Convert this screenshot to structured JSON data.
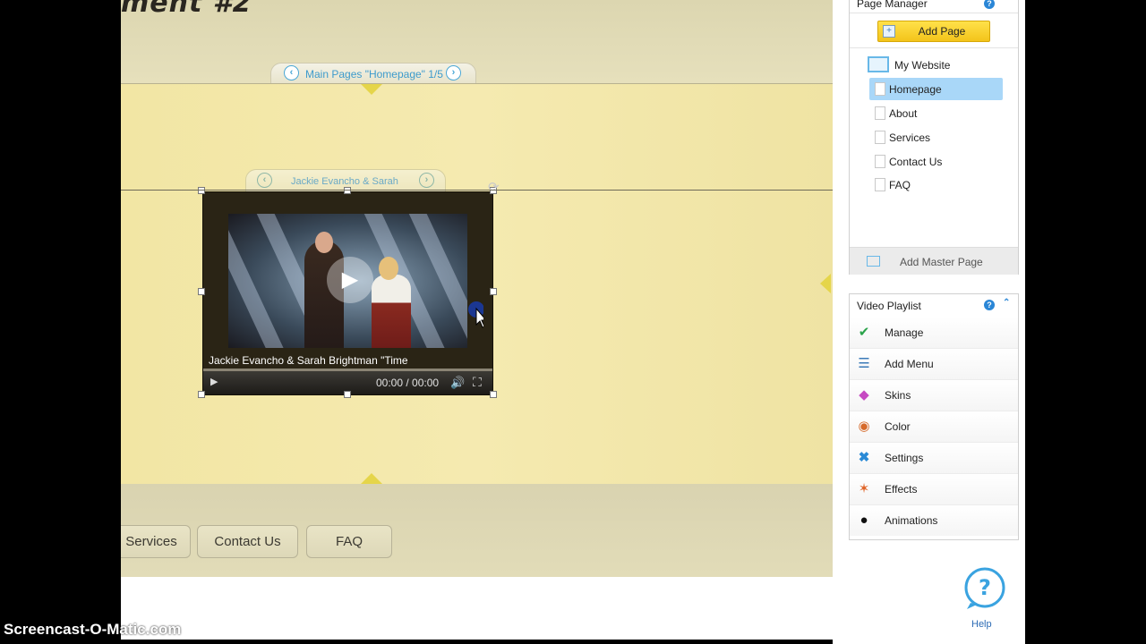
{
  "canvas": {
    "logo_text": "ment #2",
    "page_nav_label": "Main Pages \"Homepage\" 1/5",
    "video_nav_label": "Jackie Evancho & Sarah",
    "footer_nav": [
      "Services",
      "Contact Us",
      "FAQ"
    ]
  },
  "video": {
    "title": "Jackie Evancho & Sarah Brightman \"Time",
    "time": "00:00 / 00:00"
  },
  "page_manager": {
    "title": "Page Manager",
    "add_page_label": "Add Page",
    "root": "My Website",
    "pages": [
      "Homepage",
      "About",
      "Services",
      "Contact Us",
      "FAQ"
    ],
    "selected": "Homepage",
    "add_master_label": "Add Master Page"
  },
  "video_playlist": {
    "title": "Video Playlist",
    "items": [
      {
        "label": "Manage",
        "icon": "shield-check-icon"
      },
      {
        "label": "Add Menu",
        "icon": "menu-icon"
      },
      {
        "label": "Skins",
        "icon": "skins-icon"
      },
      {
        "label": "Color",
        "icon": "color-palette-icon"
      },
      {
        "label": "Settings",
        "icon": "tools-icon"
      },
      {
        "label": "Effects",
        "icon": "effects-icon"
      },
      {
        "label": "Animations",
        "icon": "mouse-ears-icon"
      }
    ]
  },
  "help_label": "Help",
  "watermark": "Screencast-O-Matic.com",
  "colors": {
    "accent_blue": "#2a86d6",
    "selection": "#a9d7f8",
    "add_page_yellow": "#f3c41a",
    "canvas_body": "#f2e6a4"
  }
}
